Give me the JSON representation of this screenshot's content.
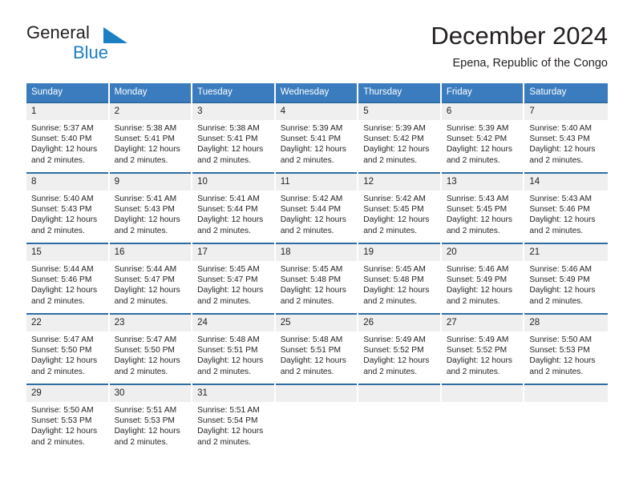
{
  "brand": {
    "line1": "General",
    "line2": "Blue",
    "mark": "triangle-logo"
  },
  "header": {
    "title": "December 2024",
    "subtitle": "Epena, Republic of the Congo"
  },
  "calendar": {
    "weekday_headers": [
      "Sunday",
      "Monday",
      "Tuesday",
      "Wednesday",
      "Thursday",
      "Friday",
      "Saturday"
    ],
    "labels": {
      "sunrise": "Sunrise:",
      "sunset": "Sunset:",
      "daylight": "Daylight:"
    },
    "accent_color": "#3a7cbe",
    "rule_color": "#2e6da4",
    "daynum_background": "#efefef",
    "weeks": [
      [
        {
          "day": "1",
          "sunrise": "Sunrise: 5:37 AM",
          "sunset": "Sunset: 5:40 PM",
          "daylight1": "Daylight: 12 hours",
          "daylight2": "and 2 minutes."
        },
        {
          "day": "2",
          "sunrise": "Sunrise: 5:38 AM",
          "sunset": "Sunset: 5:41 PM",
          "daylight1": "Daylight: 12 hours",
          "daylight2": "and 2 minutes."
        },
        {
          "day": "3",
          "sunrise": "Sunrise: 5:38 AM",
          "sunset": "Sunset: 5:41 PM",
          "daylight1": "Daylight: 12 hours",
          "daylight2": "and 2 minutes."
        },
        {
          "day": "4",
          "sunrise": "Sunrise: 5:39 AM",
          "sunset": "Sunset: 5:41 PM",
          "daylight1": "Daylight: 12 hours",
          "daylight2": "and 2 minutes."
        },
        {
          "day": "5",
          "sunrise": "Sunrise: 5:39 AM",
          "sunset": "Sunset: 5:42 PM",
          "daylight1": "Daylight: 12 hours",
          "daylight2": "and 2 minutes."
        },
        {
          "day": "6",
          "sunrise": "Sunrise: 5:39 AM",
          "sunset": "Sunset: 5:42 PM",
          "daylight1": "Daylight: 12 hours",
          "daylight2": "and 2 minutes."
        },
        {
          "day": "7",
          "sunrise": "Sunrise: 5:40 AM",
          "sunset": "Sunset: 5:43 PM",
          "daylight1": "Daylight: 12 hours",
          "daylight2": "and 2 minutes."
        }
      ],
      [
        {
          "day": "8",
          "sunrise": "Sunrise: 5:40 AM",
          "sunset": "Sunset: 5:43 PM",
          "daylight1": "Daylight: 12 hours",
          "daylight2": "and 2 minutes."
        },
        {
          "day": "9",
          "sunrise": "Sunrise: 5:41 AM",
          "sunset": "Sunset: 5:43 PM",
          "daylight1": "Daylight: 12 hours",
          "daylight2": "and 2 minutes."
        },
        {
          "day": "10",
          "sunrise": "Sunrise: 5:41 AM",
          "sunset": "Sunset: 5:44 PM",
          "daylight1": "Daylight: 12 hours",
          "daylight2": "and 2 minutes."
        },
        {
          "day": "11",
          "sunrise": "Sunrise: 5:42 AM",
          "sunset": "Sunset: 5:44 PM",
          "daylight1": "Daylight: 12 hours",
          "daylight2": "and 2 minutes."
        },
        {
          "day": "12",
          "sunrise": "Sunrise: 5:42 AM",
          "sunset": "Sunset: 5:45 PM",
          "daylight1": "Daylight: 12 hours",
          "daylight2": "and 2 minutes."
        },
        {
          "day": "13",
          "sunrise": "Sunrise: 5:43 AM",
          "sunset": "Sunset: 5:45 PM",
          "daylight1": "Daylight: 12 hours",
          "daylight2": "and 2 minutes."
        },
        {
          "day": "14",
          "sunrise": "Sunrise: 5:43 AM",
          "sunset": "Sunset: 5:46 PM",
          "daylight1": "Daylight: 12 hours",
          "daylight2": "and 2 minutes."
        }
      ],
      [
        {
          "day": "15",
          "sunrise": "Sunrise: 5:44 AM",
          "sunset": "Sunset: 5:46 PM",
          "daylight1": "Daylight: 12 hours",
          "daylight2": "and 2 minutes."
        },
        {
          "day": "16",
          "sunrise": "Sunrise: 5:44 AM",
          "sunset": "Sunset: 5:47 PM",
          "daylight1": "Daylight: 12 hours",
          "daylight2": "and 2 minutes."
        },
        {
          "day": "17",
          "sunrise": "Sunrise: 5:45 AM",
          "sunset": "Sunset: 5:47 PM",
          "daylight1": "Daylight: 12 hours",
          "daylight2": "and 2 minutes."
        },
        {
          "day": "18",
          "sunrise": "Sunrise: 5:45 AM",
          "sunset": "Sunset: 5:48 PM",
          "daylight1": "Daylight: 12 hours",
          "daylight2": "and 2 minutes."
        },
        {
          "day": "19",
          "sunrise": "Sunrise: 5:45 AM",
          "sunset": "Sunset: 5:48 PM",
          "daylight1": "Daylight: 12 hours",
          "daylight2": "and 2 minutes."
        },
        {
          "day": "20",
          "sunrise": "Sunrise: 5:46 AM",
          "sunset": "Sunset: 5:49 PM",
          "daylight1": "Daylight: 12 hours",
          "daylight2": "and 2 minutes."
        },
        {
          "day": "21",
          "sunrise": "Sunrise: 5:46 AM",
          "sunset": "Sunset: 5:49 PM",
          "daylight1": "Daylight: 12 hours",
          "daylight2": "and 2 minutes."
        }
      ],
      [
        {
          "day": "22",
          "sunrise": "Sunrise: 5:47 AM",
          "sunset": "Sunset: 5:50 PM",
          "daylight1": "Daylight: 12 hours",
          "daylight2": "and 2 minutes."
        },
        {
          "day": "23",
          "sunrise": "Sunrise: 5:47 AM",
          "sunset": "Sunset: 5:50 PM",
          "daylight1": "Daylight: 12 hours",
          "daylight2": "and 2 minutes."
        },
        {
          "day": "24",
          "sunrise": "Sunrise: 5:48 AM",
          "sunset": "Sunset: 5:51 PM",
          "daylight1": "Daylight: 12 hours",
          "daylight2": "and 2 minutes."
        },
        {
          "day": "25",
          "sunrise": "Sunrise: 5:48 AM",
          "sunset": "Sunset: 5:51 PM",
          "daylight1": "Daylight: 12 hours",
          "daylight2": "and 2 minutes."
        },
        {
          "day": "26",
          "sunrise": "Sunrise: 5:49 AM",
          "sunset": "Sunset: 5:52 PM",
          "daylight1": "Daylight: 12 hours",
          "daylight2": "and 2 minutes."
        },
        {
          "day": "27",
          "sunrise": "Sunrise: 5:49 AM",
          "sunset": "Sunset: 5:52 PM",
          "daylight1": "Daylight: 12 hours",
          "daylight2": "and 2 minutes."
        },
        {
          "day": "28",
          "sunrise": "Sunrise: 5:50 AM",
          "sunset": "Sunset: 5:53 PM",
          "daylight1": "Daylight: 12 hours",
          "daylight2": "and 2 minutes."
        }
      ],
      [
        {
          "day": "29",
          "sunrise": "Sunrise: 5:50 AM",
          "sunset": "Sunset: 5:53 PM",
          "daylight1": "Daylight: 12 hours",
          "daylight2": "and 2 minutes."
        },
        {
          "day": "30",
          "sunrise": "Sunrise: 5:51 AM",
          "sunset": "Sunset: 5:53 PM",
          "daylight1": "Daylight: 12 hours",
          "daylight2": "and 2 minutes."
        },
        {
          "day": "31",
          "sunrise": "Sunrise: 5:51 AM",
          "sunset": "Sunset: 5:54 PM",
          "daylight1": "Daylight: 12 hours",
          "daylight2": "and 2 minutes."
        },
        {
          "day": "",
          "sunrise": "",
          "sunset": "",
          "daylight1": "",
          "daylight2": ""
        },
        {
          "day": "",
          "sunrise": "",
          "sunset": "",
          "daylight1": "",
          "daylight2": ""
        },
        {
          "day": "",
          "sunrise": "",
          "sunset": "",
          "daylight1": "",
          "daylight2": ""
        },
        {
          "day": "",
          "sunrise": "",
          "sunset": "",
          "daylight1": "",
          "daylight2": ""
        }
      ]
    ]
  }
}
